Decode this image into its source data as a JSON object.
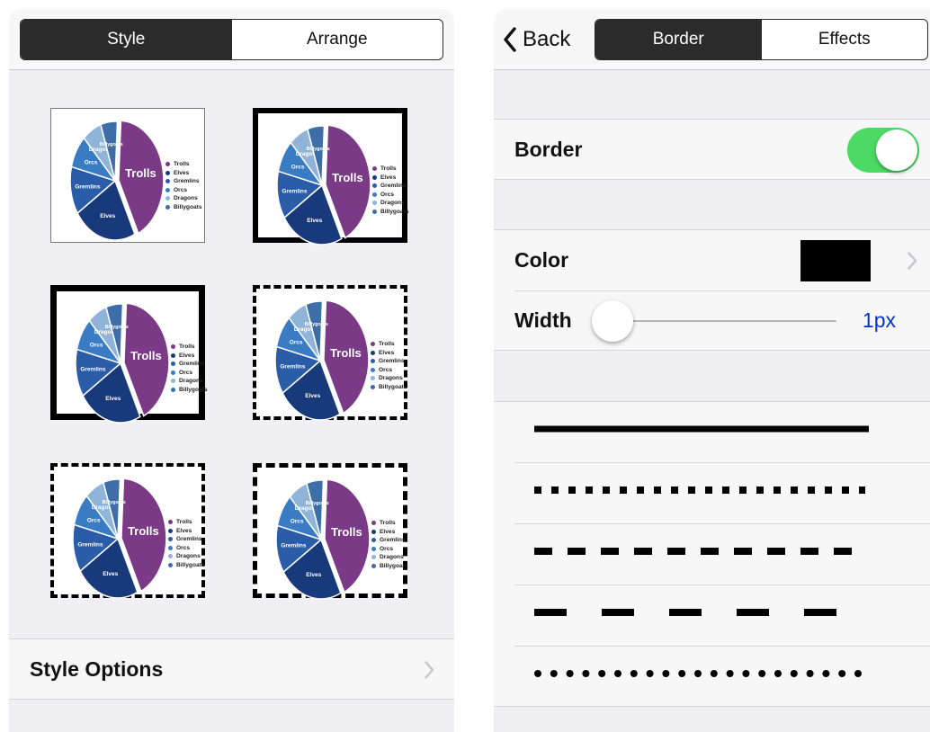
{
  "colors": {
    "panel_bg": "#efeff4",
    "row_bg": "#f7f7f7",
    "segment_dark": "#2b2b2b",
    "toggle_on": "#4cd964",
    "value_blue": "#0033cc",
    "border_color": "#000000"
  },
  "left_panel": {
    "tabs": [
      {
        "label": "Style",
        "selected": true
      },
      {
        "label": "Arrange",
        "selected": false
      }
    ],
    "thumbnail_chart": {
      "type": "pie",
      "slices": [
        "Trolls",
        "Elves",
        "Gremlins",
        "Orcs",
        "Dragons",
        "Billygoats"
      ],
      "values": [
        42,
        23,
        13,
        9,
        7,
        6
      ],
      "colors": [
        "#7a3a86",
        "#183a7a",
        "#2a5ca8",
        "#3a7cc4",
        "#8fb4d8",
        "#3d6ea8"
      ]
    },
    "style_thumbnails": [
      {
        "name": "thin-border"
      },
      {
        "name": "thick-border"
      },
      {
        "name": "heavy-border"
      },
      {
        "name": "dotted-border"
      },
      {
        "name": "dashed-border"
      },
      {
        "name": "long-dashed-border"
      }
    ],
    "style_options": {
      "label": "Style Options",
      "icon": "chevron-right-icon"
    }
  },
  "right_panel": {
    "back_label": "Back",
    "tabs": [
      {
        "label": "Border",
        "selected": true
      },
      {
        "label": "Effects",
        "selected": false
      }
    ],
    "border_toggle": {
      "label": "Border",
      "on": true
    },
    "color": {
      "label": "Color",
      "value": "#000000"
    },
    "width": {
      "label": "Width",
      "value_text": "1px",
      "slider_fraction": 0.0
    },
    "line_styles": [
      {
        "name": "solid",
        "selected": true
      },
      {
        "name": "dotted-square",
        "selected": false
      },
      {
        "name": "dashed",
        "selected": false
      },
      {
        "name": "long-dashed",
        "selected": false
      },
      {
        "name": "round-dotted",
        "selected": false
      }
    ]
  }
}
